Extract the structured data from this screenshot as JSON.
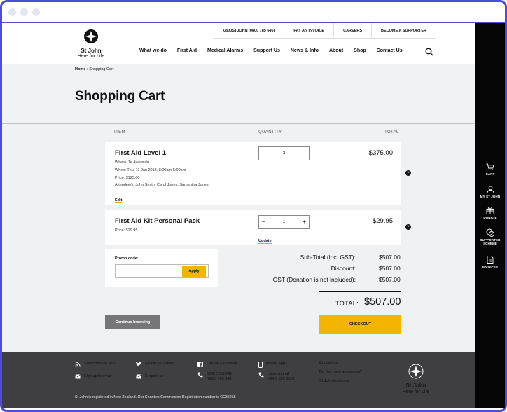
{
  "header": {
    "logo_name": "St John",
    "logo_tagline": "Here for Life",
    "utility": [
      "0800STJOHN (0800 785 646)",
      "PAY AN INVOICE",
      "CAREERS",
      "BECOME A SUPPORTER"
    ],
    "nav": [
      "What we do",
      "First Aid",
      "Medical Alarms",
      "Support Us",
      "News & Info",
      "About",
      "Shop",
      "Contact Us"
    ]
  },
  "breadcrumb": {
    "home": "Home",
    "current": "Shopping Cart"
  },
  "page_title": "Shopping Cart",
  "cart": {
    "headers": {
      "item": "ITEM",
      "quantity": "QUANTITY",
      "total": "TOTAL"
    },
    "items": [
      {
        "name": "First Aid Level 1",
        "details": [
          "Where: Te Awamutu",
          "When: Thu, 11 Jan 2018, 8:00am-5:00pm",
          "Price: $125.00",
          "Attendee/s: John Smith, Carol Jones, Samantha Jones"
        ],
        "quantity": "3",
        "total": "$375.00",
        "action": "Edit"
      },
      {
        "name": "First Aid Kit Personal Pack",
        "details": [
          "Price: $29.95"
        ],
        "quantity": "1",
        "total": "$29.95",
        "action": "Update",
        "minus": "–",
        "plus": "+"
      }
    ],
    "remove_symbol": "×"
  },
  "promo": {
    "label": "Promo code:",
    "placeholder": "",
    "button": "Apply"
  },
  "summary": {
    "subtotal_label": "Sub-Total (inc. GST):",
    "subtotal": "$507.00",
    "discount_label": "Discount:",
    "discount": "$507.00",
    "gst_label": "GST (Donation is not included):",
    "gst": "$507.00",
    "total_label": "TOTAL:",
    "total": "$507.00",
    "checkout": "CHECKOUT",
    "continue": "Continue browsing"
  },
  "sidebar": [
    "CART",
    "MY ST JOHN",
    "DONATE",
    "SUPPORTER SCHEME",
    "INVOICES"
  ],
  "footer": {
    "col1": [
      "Subscribe via RSS",
      "Sign up to email"
    ],
    "col2": [
      "Follow on Twitter",
      "Enquire us"
    ],
    "col3": [
      "Like on Facebook",
      "0800 STJOHN",
      "(0800 785 646)"
    ],
    "col4": [
      "Mobile Apps",
      "International",
      "+64 9 526 0528"
    ],
    "contact": [
      "Contact us",
      "Do you have a question?",
      "St John locations"
    ],
    "logo_name": "St John",
    "logo_tagline": "Here for Life",
    "note": "St John is registered in New Zealand. Our Charities Commission Registration number is CC35255"
  },
  "colors": {
    "accent": "#F5B400",
    "footer": "#3F3F41",
    "sidebar": "#050505",
    "frame": "#4A4FD6"
  }
}
